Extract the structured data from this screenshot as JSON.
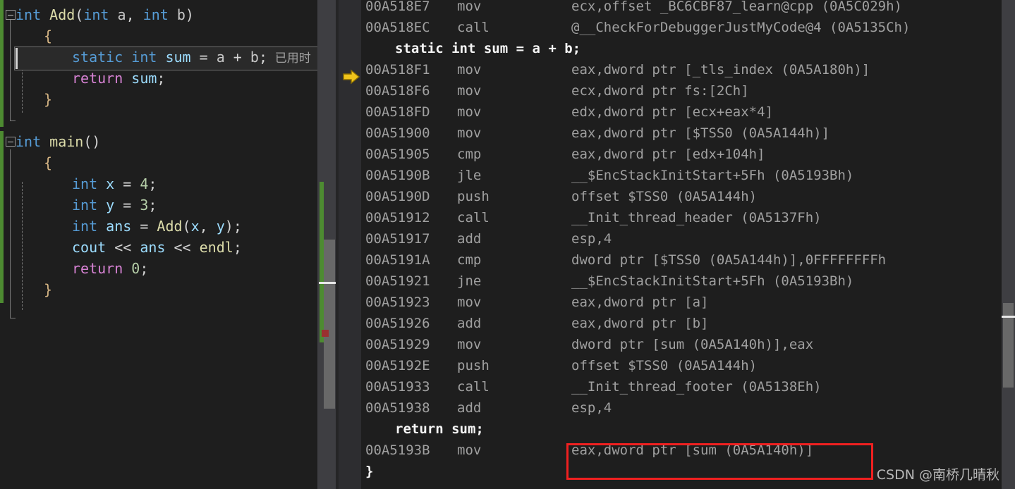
{
  "editor": {
    "language": "cpp",
    "current_line_codelens": "已用时",
    "lines": [
      {
        "indent": 0,
        "fold": true,
        "tokens": [
          {
            "t": "int",
            "c": "kw"
          },
          {
            "t": " ",
            "c": "pun"
          },
          {
            "t": "Add",
            "c": "fn"
          },
          {
            "t": "(",
            "c": "pun"
          },
          {
            "t": "int",
            "c": "kw"
          },
          {
            "t": " ",
            "c": "pun"
          },
          {
            "t": "a",
            "c": "plain"
          },
          {
            "t": ", ",
            "c": "pun"
          },
          {
            "t": "int",
            "c": "kw"
          },
          {
            "t": " ",
            "c": "pun"
          },
          {
            "t": "b",
            "c": "plain"
          },
          {
            "t": ")",
            "c": "pun"
          }
        ]
      },
      {
        "indent": 1,
        "fold": false,
        "tokens": [
          {
            "t": "{",
            "c": "brace"
          }
        ]
      },
      {
        "indent": 2,
        "fold": false,
        "current": true,
        "tokens": [
          {
            "t": "static",
            "c": "kw"
          },
          {
            "t": " ",
            "c": "pun"
          },
          {
            "t": "int",
            "c": "kw"
          },
          {
            "t": " ",
            "c": "pun"
          },
          {
            "t": "sum",
            "c": "id"
          },
          {
            "t": " = ",
            "c": "pun"
          },
          {
            "t": "a",
            "c": "plain"
          },
          {
            "t": " + ",
            "c": "pun"
          },
          {
            "t": "b",
            "c": "plain"
          },
          {
            "t": ";",
            "c": "pun"
          }
        ]
      },
      {
        "indent": 2,
        "fold": false,
        "tokens": [
          {
            "t": "return",
            "c": "ret"
          },
          {
            "t": " ",
            "c": "pun"
          },
          {
            "t": "sum",
            "c": "id"
          },
          {
            "t": ";",
            "c": "pun"
          }
        ]
      },
      {
        "indent": 1,
        "fold": false,
        "tokens": [
          {
            "t": "}",
            "c": "brace"
          }
        ]
      },
      {
        "indent": 0,
        "fold": false,
        "tokens": []
      },
      {
        "indent": 0,
        "fold": true,
        "tokens": [
          {
            "t": "int",
            "c": "kw"
          },
          {
            "t": " ",
            "c": "pun"
          },
          {
            "t": "main",
            "c": "fn"
          },
          {
            "t": "()",
            "c": "pun"
          }
        ]
      },
      {
        "indent": 1,
        "fold": false,
        "tokens": [
          {
            "t": "{",
            "c": "brace"
          }
        ]
      },
      {
        "indent": 2,
        "fold": false,
        "tokens": [
          {
            "t": "int",
            "c": "kw"
          },
          {
            "t": " ",
            "c": "pun"
          },
          {
            "t": "x",
            "c": "id"
          },
          {
            "t": " = ",
            "c": "pun"
          },
          {
            "t": "4",
            "c": "num"
          },
          {
            "t": ";",
            "c": "pun"
          }
        ]
      },
      {
        "indent": 2,
        "fold": false,
        "tokens": [
          {
            "t": "int",
            "c": "kw"
          },
          {
            "t": " ",
            "c": "pun"
          },
          {
            "t": "y",
            "c": "id"
          },
          {
            "t": " = ",
            "c": "pun"
          },
          {
            "t": "3",
            "c": "num"
          },
          {
            "t": ";",
            "c": "pun"
          }
        ]
      },
      {
        "indent": 2,
        "fold": false,
        "tokens": [
          {
            "t": "int",
            "c": "kw"
          },
          {
            "t": " ",
            "c": "pun"
          },
          {
            "t": "ans",
            "c": "id"
          },
          {
            "t": " = ",
            "c": "pun"
          },
          {
            "t": "Add",
            "c": "fn"
          },
          {
            "t": "(",
            "c": "pun"
          },
          {
            "t": "x",
            "c": "id"
          },
          {
            "t": ", ",
            "c": "pun"
          },
          {
            "t": "y",
            "c": "id"
          },
          {
            "t": ");",
            "c": "pun"
          }
        ]
      },
      {
        "indent": 2,
        "fold": false,
        "tokens": [
          {
            "t": "cout",
            "c": "id"
          },
          {
            "t": " << ",
            "c": "pun"
          },
          {
            "t": "ans",
            "c": "id"
          },
          {
            "t": " << ",
            "c": "pun"
          },
          {
            "t": "endl",
            "c": "fn"
          },
          {
            "t": ";",
            "c": "pun"
          }
        ]
      },
      {
        "indent": 2,
        "fold": false,
        "tokens": [
          {
            "t": "return",
            "c": "ret"
          },
          {
            "t": " ",
            "c": "pun"
          },
          {
            "t": "0",
            "c": "num"
          },
          {
            "t": ";",
            "c": "pun"
          }
        ]
      },
      {
        "indent": 1,
        "fold": false,
        "tokens": [
          {
            "t": "}",
            "c": "brace"
          }
        ]
      }
    ]
  },
  "disassembly": {
    "execution_marker": {
      "icon": "execution-arrow-icon",
      "address": "00A518F1",
      "color": "#f0c41b"
    },
    "rows": [
      {
        "kind": "asm",
        "address": "00A518E7",
        "mnemonic": "mov",
        "operands": "ecx,offset _BC6CBF87_learn@cpp (0A5C029h)"
      },
      {
        "kind": "asm",
        "address": "00A518EC",
        "mnemonic": "call",
        "operands": "@__CheckForDebuggerJustMyCode@4 (0A5135Ch)"
      },
      {
        "kind": "src",
        "text": "static int sum = a + b;"
      },
      {
        "kind": "asm",
        "address": "00A518F1",
        "mnemonic": "mov",
        "operands": "eax,dword ptr [_tls_index (0A5A180h)]",
        "current": true
      },
      {
        "kind": "asm",
        "address": "00A518F6",
        "mnemonic": "mov",
        "operands": "ecx,dword ptr fs:[2Ch]"
      },
      {
        "kind": "asm",
        "address": "00A518FD",
        "mnemonic": "mov",
        "operands": "edx,dword ptr [ecx+eax*4]"
      },
      {
        "kind": "asm",
        "address": "00A51900",
        "mnemonic": "mov",
        "operands": "eax,dword ptr [$TSS0 (0A5A144h)]"
      },
      {
        "kind": "asm",
        "address": "00A51905",
        "mnemonic": "cmp",
        "operands": "eax,dword ptr [edx+104h]"
      },
      {
        "kind": "asm",
        "address": "00A5190B",
        "mnemonic": "jle",
        "operands": "__$EncStackInitStart+5Fh (0A5193Bh)"
      },
      {
        "kind": "asm",
        "address": "00A5190D",
        "mnemonic": "push",
        "operands": "offset $TSS0 (0A5A144h)"
      },
      {
        "kind": "asm",
        "address": "00A51912",
        "mnemonic": "call",
        "operands": "__Init_thread_header (0A5137Fh)"
      },
      {
        "kind": "asm",
        "address": "00A51917",
        "mnemonic": "add",
        "operands": "esp,4"
      },
      {
        "kind": "asm",
        "address": "00A5191A",
        "mnemonic": "cmp",
        "operands": "dword ptr [$TSS0 (0A5A144h)],0FFFFFFFFh"
      },
      {
        "kind": "asm",
        "address": "00A51921",
        "mnemonic": "jne",
        "operands": "__$EncStackInitStart+5Fh (0A5193Bh)"
      },
      {
        "kind": "asm",
        "address": "00A51923",
        "mnemonic": "mov",
        "operands": "eax,dword ptr [a]"
      },
      {
        "kind": "asm",
        "address": "00A51926",
        "mnemonic": "add",
        "operands": "eax,dword ptr [b]"
      },
      {
        "kind": "asm",
        "address": "00A51929",
        "mnemonic": "mov",
        "operands": "dword ptr [sum (0A5A140h)],eax"
      },
      {
        "kind": "asm",
        "address": "00A5192E",
        "mnemonic": "push",
        "operands": "offset $TSS0 (0A5A144h)"
      },
      {
        "kind": "asm",
        "address": "00A51933",
        "mnemonic": "call",
        "operands": "__Init_thread_footer (0A5138Eh)"
      },
      {
        "kind": "asm",
        "address": "00A51938",
        "mnemonic": "add",
        "operands": "esp,4"
      },
      {
        "kind": "src",
        "text": "return sum;"
      },
      {
        "kind": "asm",
        "address": "00A5193B",
        "mnemonic": "mov",
        "operands": "eax,dword ptr [sum (0A5A140h)]",
        "annotated": true
      },
      {
        "kind": "brace",
        "text": "}"
      }
    ]
  },
  "annotation": {
    "shape": "rectangle",
    "color": "#f02020",
    "target_text": "eax,dword ptr [sum (0A5A140h)]"
  },
  "scrollbars": {
    "left": {
      "change_color": "#4d8b31",
      "thumb_color": "#686868",
      "caret_color": "#e8e8e8",
      "mark_color": "#9b3030"
    },
    "right": {
      "thumb_color": "#686868",
      "caret_color": "#e8e8e8"
    }
  },
  "watermark": {
    "text": "CSDN @南桥几晴秋"
  }
}
